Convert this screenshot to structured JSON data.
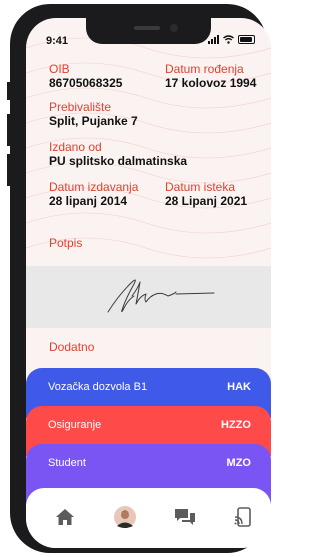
{
  "status_bar": {
    "time": "9:41"
  },
  "fields": {
    "oib": {
      "label": "OIB",
      "value": "86705068325"
    },
    "datum_rodenja": {
      "label": "Datum rođenja",
      "value": "17 kolovoz 1994"
    },
    "prebivaliste": {
      "label": "Prebivalište",
      "value": "Split, Pujanke 7"
    },
    "izdano_od": {
      "label": "Izdano od",
      "value": "PU splitsko dalmatinska"
    },
    "datum_izdavanja": {
      "label": "Datum izdavanja",
      "value": "28 lipanj 2014"
    },
    "datum_isteka": {
      "label": "Datum isteka",
      "value": "28 Lipanj 2021"
    }
  },
  "potpis_label": "Potpis",
  "dodatno_label": "Dodatno",
  "cards": [
    {
      "name": "Vozačka dozvola B1",
      "code": "HAK",
      "color": "#3f59e8"
    },
    {
      "name": "Osiguranje",
      "code": "HZZO",
      "color": "#ff4a4a"
    },
    {
      "name": "Student",
      "code": "MZO",
      "color": "#7a55f4"
    }
  ],
  "tabbar": {
    "icons": [
      "home-icon",
      "avatar",
      "chat-icon",
      "nfc-phone-icon"
    ],
    "icon_color": "#5c5c5c"
  },
  "colors": {
    "label": "#e4402f",
    "background": "#fbf3f1"
  }
}
